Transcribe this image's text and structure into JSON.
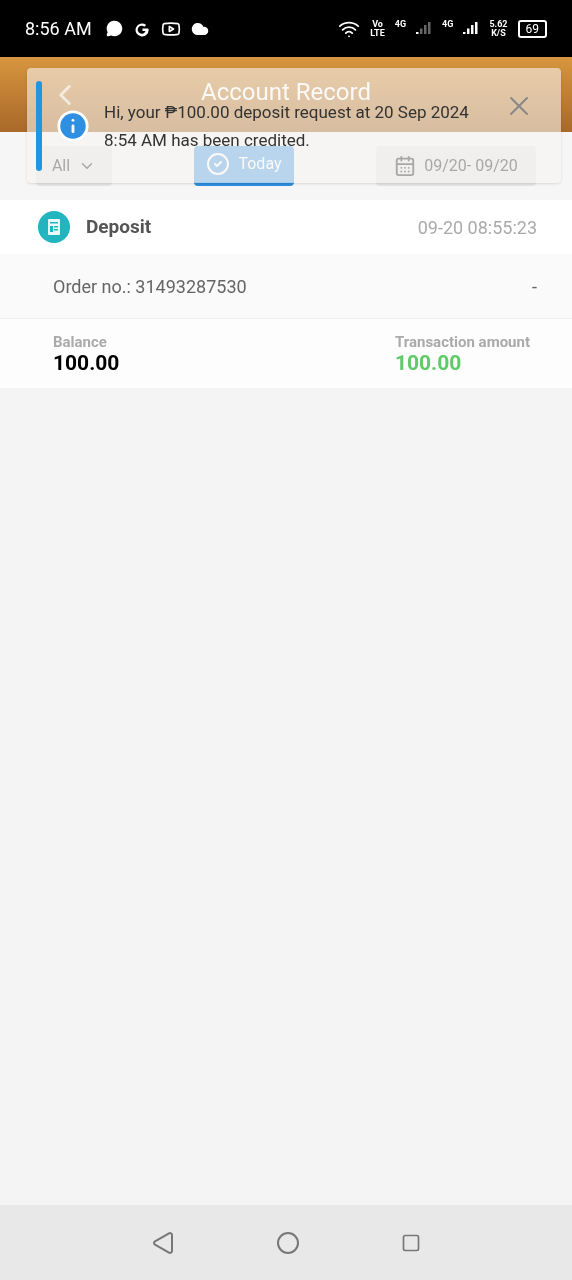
{
  "status_bar": {
    "time": "8:56 AM",
    "volte": [
      "Vo",
      "LTE"
    ],
    "network_1": "4G",
    "network_2": "4G",
    "speed": [
      "5.62",
      "K/S"
    ],
    "battery": "69"
  },
  "header": {
    "title": "Account Record"
  },
  "filters": [
    {
      "kind": "dropdown",
      "label": "All",
      "selected": false
    },
    {
      "kind": "button",
      "label": "Today",
      "selected": true
    },
    {
      "kind": "date",
      "label": "09/20- 09/20",
      "selected": false
    }
  ],
  "records": [
    {
      "type": "Deposit",
      "time": "09-20 08:55:23",
      "order": "Order no.: 31493287530",
      "order_extra": "-",
      "balance_label": "Balance",
      "balance": "100.00",
      "amount_label": "Transaction amount",
      "amount": "100.00"
    }
  ],
  "notification": {
    "message": "Hi, your ₱100.00 deposit request at 20 Sep 2024 8:54 AM has been credited."
  }
}
